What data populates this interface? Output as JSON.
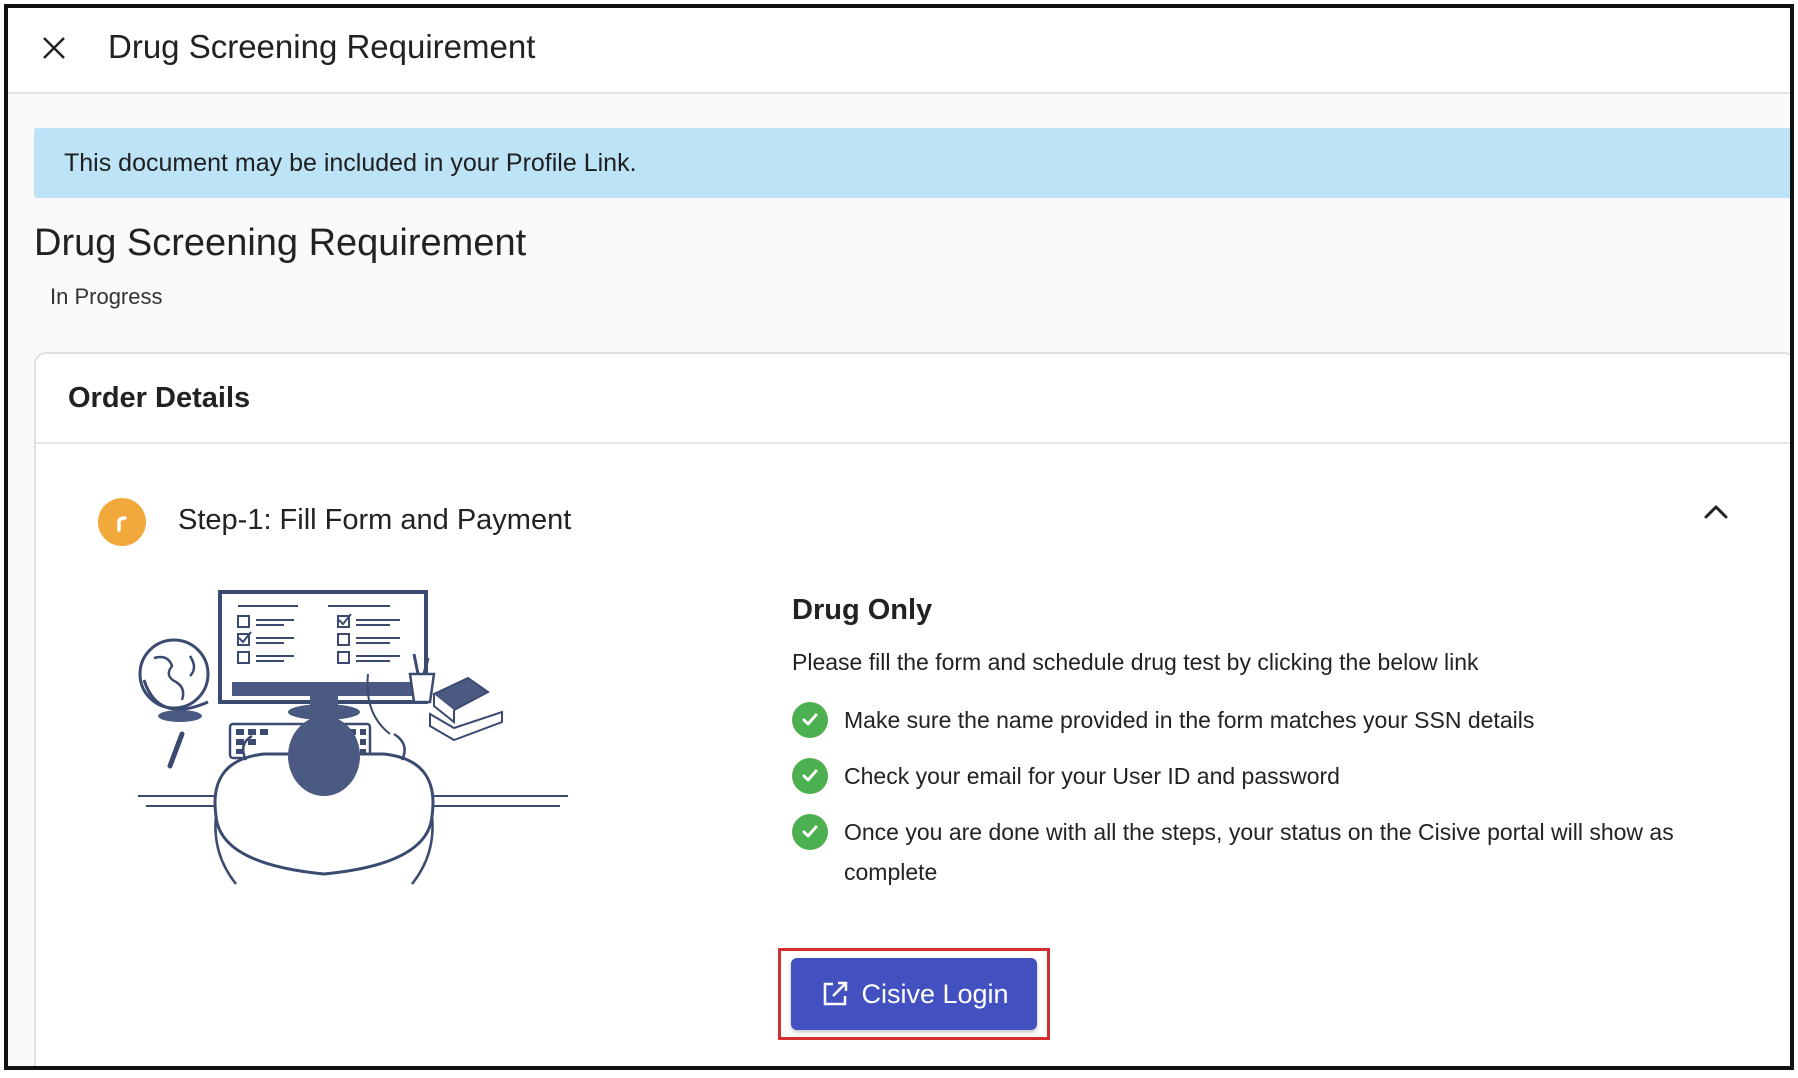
{
  "header": {
    "title": "Drug Screening Requirement",
    "close_icon": "close-icon"
  },
  "banner": {
    "text": "This document may be included in your Profile Link.",
    "color": "#bde3f6"
  },
  "page": {
    "title": "Drug Screening Requirement",
    "status": "In Progress"
  },
  "order_details": {
    "title": "Order Details",
    "step": {
      "label": "Step-1: Fill Form and Payment",
      "icon": "clock-progress-icon",
      "icon_color": "#f2a93b",
      "expanded": true
    },
    "content": {
      "title": "Drug Only",
      "description": "Please fill the form and schedule drug test by clicking the below link",
      "checklist": [
        "Make sure the name provided in the form matches your SSN details",
        "Check your email for your User ID and password",
        "Once you are done with all the steps, your status on the Cisive portal will show as complete"
      ],
      "check_color": "#4caf50"
    },
    "login_button": {
      "label": "Cisive Login",
      "icon": "external-link-icon",
      "color": "#4350c0",
      "highlight_color": "#d32f2f"
    }
  }
}
